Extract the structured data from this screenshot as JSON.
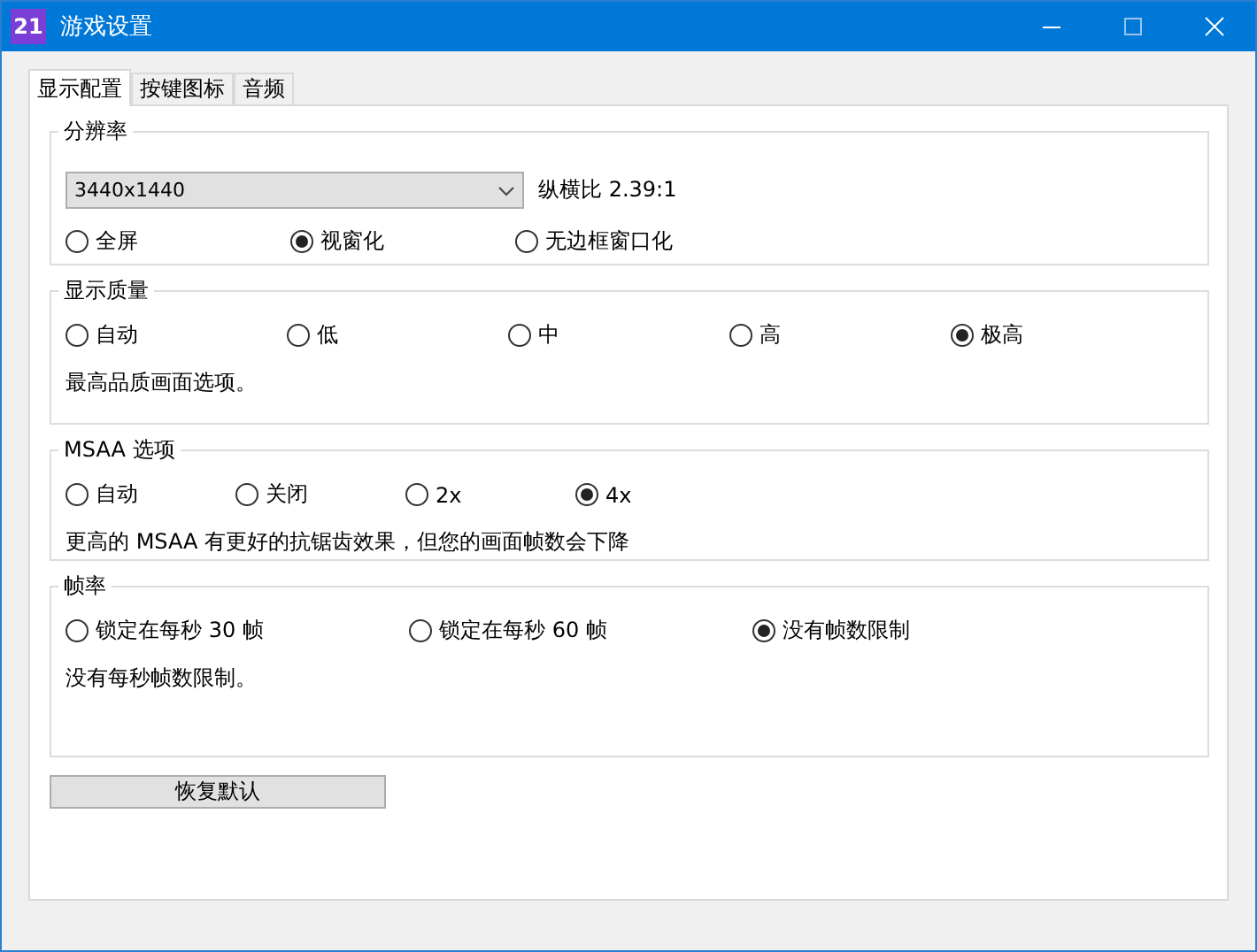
{
  "window": {
    "title": "游戏设置",
    "app_icon_text": "21"
  },
  "tabs": [
    {
      "label": "显示配置",
      "selected": true
    },
    {
      "label": "按键图标",
      "selected": false
    },
    {
      "label": "音频",
      "selected": false
    }
  ],
  "groups": [
    {
      "title": "分辨率",
      "dropdown": {
        "value": "3440x1440"
      },
      "aspect": "纵横比 2.39:1",
      "options": [
        {
          "label": "全屏",
          "selected": false
        },
        {
          "label": "视窗化",
          "selected": true
        },
        {
          "label": "无边框窗口化",
          "selected": false
        }
      ]
    },
    {
      "title": "显示质量",
      "options": [
        {
          "label": "自动",
          "selected": false
        },
        {
          "label": "低",
          "selected": false
        },
        {
          "label": "中",
          "selected": false
        },
        {
          "label": "高",
          "selected": false
        },
        {
          "label": "极高",
          "selected": true
        }
      ],
      "description": "最高品质画面选项。"
    },
    {
      "title": "MSAA 选项",
      "options": [
        {
          "label": "自动",
          "selected": false
        },
        {
          "label": "关闭",
          "selected": false
        },
        {
          "label": "2x",
          "selected": false
        },
        {
          "label": "4x",
          "selected": true
        }
      ],
      "description": "更高的 MSAA 有更好的抗锯齿效果，但您的画面帧数会下降"
    },
    {
      "title": "帧率",
      "options": [
        {
          "label": "锁定在每秒 30 帧",
          "selected": false
        },
        {
          "label": "锁定在每秒 60 帧",
          "selected": false
        },
        {
          "label": "没有帧数限制",
          "selected": true
        }
      ],
      "description": "没有每秒帧数限制。"
    }
  ],
  "reset_button": "恢复默认"
}
